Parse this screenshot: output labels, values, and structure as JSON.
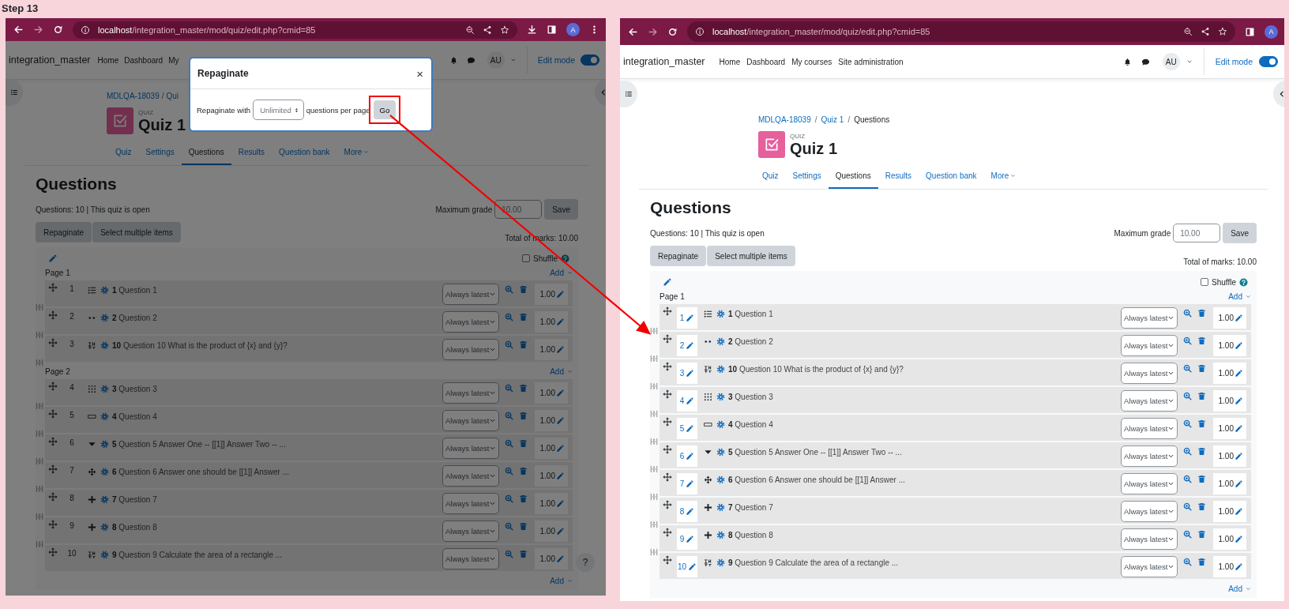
{
  "step_label": "Step 13",
  "screens": [
    {
      "browser": {
        "host": "localhost",
        "path": "/integration_master/mod/quiz/edit.php?cmid=85",
        "avatar": "A",
        "tools": [
          {
            "kind": "download"
          },
          {
            "kind": "panel"
          },
          {
            "kind": "avatar"
          },
          {
            "kind": "menu"
          }
        ]
      },
      "site": {
        "name": "integration_master",
        "nav": [
          "Home",
          "Dashboard",
          "My"
        ],
        "user": "AU",
        "edit_mode": {
          "label": "Edit mode",
          "on": true
        }
      },
      "breadcrumb": [
        "MDLQA-18039",
        "Qui"
      ],
      "breadcrumb_separator": "/",
      "module_label": "QUIZ",
      "title": "Quiz 1",
      "tabs": [
        {
          "label": "Quiz",
          "selected": false
        },
        {
          "label": "Settings",
          "selected": false
        },
        {
          "label": "Questions",
          "selected": true
        },
        {
          "label": "Results",
          "selected": false
        },
        {
          "label": "Question bank",
          "selected": false
        },
        {
          "label": "More",
          "selected": false,
          "menu": true
        }
      ],
      "heading": "Questions",
      "summary": "Questions: 10 | This quiz is open",
      "grade": {
        "label": "Maximum grade",
        "value": "10.00",
        "button": "Save"
      },
      "actions": [
        "Repaginate",
        "Select multiple items"
      ],
      "total": "Total of marks: 10.00",
      "shuffle": {
        "label": "Shuffle",
        "checked": false
      },
      "slot_editable": false,
      "pages": [
        {
          "label": "Page 1",
          "add": "Add",
          "questions": [
            {
              "slot": "1",
              "kind": "multichoice",
              "text": "**1** Question 1",
              "version": "Always latest",
              "mark": "1.00"
            },
            {
              "slot": "2",
              "kind": "truefalse",
              "text": "**2** Question 2",
              "version": "Always latest",
              "mark": "1.00"
            },
            {
              "slot": "3",
              "kind": "calculated",
              "text": "**10** Question 10 What is the product of {x} and {y}?",
              "version": "Always latest",
              "mark": "1.00"
            }
          ]
        },
        {
          "label": "Page 2",
          "add": "Add",
          "questions": [
            {
              "slot": "4",
              "kind": "matching",
              "text": "**3** Question 3",
              "version": "Always latest",
              "mark": "1.00"
            },
            {
              "slot": "5",
              "kind": "shortanswer",
              "text": "**4** Question 4",
              "version": "Always latest",
              "mark": "1.00"
            },
            {
              "slot": "6",
              "kind": "gapselect",
              "text": "**5** Question 5 Answer One -- [[1]] Answer Two -- ...",
              "version": "Always latest",
              "mark": "1.00"
            },
            {
              "slot": "7",
              "kind": "ddwtos",
              "text": "**6** Question 6 Answer one should be [[1]] Answer ...",
              "version": "Always latest",
              "mark": "1.00"
            },
            {
              "slot": "8",
              "kind": "ddimageortext",
              "text": "**7** Question 7",
              "version": "Always latest",
              "mark": "1.00"
            },
            {
              "slot": "9",
              "kind": "ddimageortext",
              "text": "**8** Question 8",
              "version": "Always latest",
              "mark": "1.00"
            },
            {
              "slot": "10",
              "kind": "calculated",
              "text": "**9** Question 9 Calculate the area of a rectangle ...",
              "version": "Always latest",
              "mark": "1.00"
            }
          ]
        }
      ],
      "final_add": "Add",
      "help": "?",
      "dialog": {
        "title": "Repaginate",
        "close": "×",
        "label_before": "Repaginate with",
        "select_value": "Unlimited",
        "label_after": "questions per page",
        "go": {
          "label": "Go",
          "highlighted": true
        }
      }
    },
    {
      "browser": {
        "host": "localhost",
        "path": "/integration_master/mod/quiz/edit.php?cmid=85",
        "avatar": "A",
        "tools": [
          {
            "kind": "panel"
          },
          {
            "kind": "avatar"
          }
        ]
      },
      "site": {
        "name": "integration_master",
        "nav": [
          "Home",
          "Dashboard",
          "My courses",
          "Site administration"
        ],
        "user": "AU",
        "edit_mode": {
          "label": "Edit mode",
          "on": true
        }
      },
      "breadcrumb": [
        "MDLQA-18039",
        "Quiz 1",
        "Questions"
      ],
      "breadcrumb_separator": "/",
      "module_label": "QUIZ",
      "title": "Quiz 1",
      "tabs": [
        {
          "label": "Quiz",
          "selected": false
        },
        {
          "label": "Settings",
          "selected": false
        },
        {
          "label": "Questions",
          "selected": true
        },
        {
          "label": "Results",
          "selected": false
        },
        {
          "label": "Question bank",
          "selected": false
        },
        {
          "label": "More",
          "selected": false,
          "menu": true
        }
      ],
      "heading": "Questions",
      "summary": "Questions: 10 | This quiz is open",
      "grade": {
        "label": "Maximum grade",
        "value": "10.00",
        "button": "Save"
      },
      "actions": [
        "Repaginate",
        "Select multiple items"
      ],
      "total": "Total of marks: 10.00",
      "shuffle": {
        "label": "Shuffle",
        "checked": false
      },
      "slot_editable": true,
      "pages": [
        {
          "label": "Page 1",
          "add": "Add",
          "questions": [
            {
              "slot": "1",
              "kind": "multichoice",
              "text": "**1** Question 1",
              "version": "Always latest",
              "mark": "1.00"
            },
            {
              "slot": "2",
              "kind": "truefalse",
              "text": "**2** Question 2",
              "version": "Always latest",
              "mark": "1.00"
            },
            {
              "slot": "3",
              "kind": "calculated",
              "text": "**10** Question 10 What is the product of {x} and {y}?",
              "version": "Always latest",
              "mark": "1.00"
            },
            {
              "slot": "4",
              "kind": "matching",
              "text": "**3** Question 3",
              "version": "Always latest",
              "mark": "1.00"
            },
            {
              "slot": "5",
              "kind": "shortanswer",
              "text": "**4** Question 4",
              "version": "Always latest",
              "mark": "1.00"
            },
            {
              "slot": "6",
              "kind": "gapselect",
              "text": "**5** Question 5 Answer One -- [[1]] Answer Two -- ...",
              "version": "Always latest",
              "mark": "1.00"
            },
            {
              "slot": "7",
              "kind": "ddwtos",
              "text": "**6** Question 6 Answer one should be [[1]] Answer ...",
              "version": "Always latest",
              "mark": "1.00"
            },
            {
              "slot": "8",
              "kind": "ddimageortext",
              "text": "**7** Question 7",
              "version": "Always latest",
              "mark": "1.00"
            },
            {
              "slot": "9",
              "kind": "ddimageortext",
              "text": "**8** Question 8",
              "version": "Always latest",
              "mark": "1.00"
            },
            {
              "slot": "10",
              "kind": "calculated",
              "text": "**9** Question 9 Calculate the area of a rectangle ...",
              "version": "Always latest",
              "mark": "1.00"
            }
          ]
        }
      ],
      "final_add": "Add"
    }
  ]
}
